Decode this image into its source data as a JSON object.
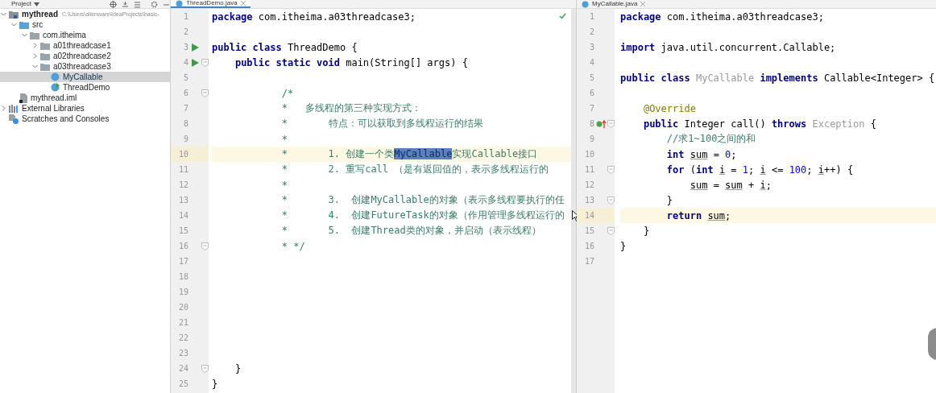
{
  "project_panel": {
    "title": "Project",
    "tree": [
      {
        "label": "mythread",
        "path": "C:\\Users\\alienware\\IdeaProjects\\basic-",
        "kind": "module",
        "expanded": true,
        "selected": false,
        "children": [
          {
            "label": "src",
            "kind": "source",
            "expanded": true,
            "selected": false,
            "children": [
              {
                "label": "com.itheima",
                "kind": "package",
                "expanded": true,
                "selected": false,
                "children": [
                  {
                    "label": "a01threadcase1",
                    "kind": "package",
                    "expanded": false,
                    "selected": false
                  },
                  {
                    "label": "a02threadcase2",
                    "kind": "package",
                    "expanded": false,
                    "selected": false
                  },
                  {
                    "label": "a03threadcase3",
                    "kind": "package",
                    "expanded": true,
                    "selected": false,
                    "children": [
                      {
                        "label": "MyCallable",
                        "kind": "class",
                        "selected": true
                      },
                      {
                        "label": "ThreadDemo",
                        "kind": "main-class",
                        "selected": false
                      }
                    ]
                  }
                ]
              }
            ]
          },
          {
            "label": "mythread.iml",
            "kind": "file",
            "selected": false
          }
        ]
      },
      {
        "label": "External Libraries",
        "kind": "libraries",
        "expanded": false,
        "selected": false
      },
      {
        "label": "Scratches and Consoles",
        "kind": "scratches",
        "selected": false
      }
    ]
  },
  "editors": [
    {
      "tab": {
        "label": "ThreadDemo.java",
        "selected": true
      },
      "lines": [
        {
          "number": "1",
          "fold": false,
          "current": false,
          "tokens": [
            {
              "kind": "keyword",
              "text": "package"
            },
            {
              "kind": "plain",
              "text": " com.itheima.a03threadcase3;"
            }
          ]
        },
        {
          "number": "2",
          "fold": false,
          "current": false
        },
        {
          "number": "3",
          "fold": false,
          "current": false,
          "gutter_icon": {
            "kind": "run"
          },
          "tokens": [
            {
              "kind": "keyword",
              "text": "public class"
            },
            {
              "kind": "plain",
              "text": " ThreadDemo {"
            }
          ]
        },
        {
          "number": "4",
          "fold": true,
          "current": false,
          "gutter_icon": {
            "kind": "run"
          },
          "tokens": [
            {
              "kind": "keyword",
              "text": "    public static void"
            },
            {
              "kind": "plain",
              "text": " main(String[] args) {"
            }
          ]
        },
        {
          "number": "5",
          "fold": false,
          "current": false
        },
        {
          "number": "6",
          "fold": true,
          "current": false,
          "tokens": [
            {
              "kind": "comment",
              "text": "            /*"
            }
          ]
        },
        {
          "number": "7",
          "fold": false,
          "current": false,
          "tokens": [
            {
              "kind": "comment",
              "text": "            *   多线程的第三种实现方式："
            }
          ]
        },
        {
          "number": "8",
          "fold": false,
          "current": false,
          "tokens": [
            {
              "kind": "comment",
              "text": "            *       特点：可以获取到多线程运行的结果"
            }
          ]
        },
        {
          "number": "9",
          "fold": false,
          "current": false,
          "tokens": [
            {
              "kind": "comment",
              "text": "            *"
            }
          ]
        },
        {
          "number": "10",
          "fold": false,
          "current": true,
          "tokens": [
            {
              "kind": "comment",
              "text": "            *       1. 创建一个类"
            },
            {
              "kind": "selection",
              "text": "MyCallable"
            },
            {
              "kind": "comment",
              "text": "实现Callable接口"
            }
          ]
        },
        {
          "number": "11",
          "fold": false,
          "current": false,
          "tokens": [
            {
              "kind": "comment",
              "text": "            *       2. 重写call （是有返回值的，表示多线程运行的"
            }
          ]
        },
        {
          "number": "12",
          "fold": false,
          "current": false,
          "tokens": [
            {
              "kind": "comment",
              "text": "            *"
            }
          ]
        },
        {
          "number": "13",
          "fold": false,
          "current": false,
          "tokens": [
            {
              "kind": "comment",
              "text": "            *       3.  创建MyCallable的对象（表示多线程要执行的任"
            }
          ]
        },
        {
          "number": "14",
          "fold": false,
          "current": false,
          "tokens": [
            {
              "kind": "comment",
              "text": "            *       4.  创建FutureTask的对象（作用管理多线程运行的"
            }
          ]
        },
        {
          "number": "15",
          "fold": false,
          "current": false,
          "tokens": [
            {
              "kind": "comment",
              "text": "            *       5.  创建Thread类的对象，并启动（表示线程）"
            }
          ]
        },
        {
          "number": "16",
          "fold": true,
          "current": false,
          "tokens": [
            {
              "kind": "comment",
              "text": "            * */"
            }
          ]
        },
        {
          "number": "17",
          "fold": false,
          "current": false
        },
        {
          "number": "18",
          "fold": false,
          "current": false
        },
        {
          "number": "19",
          "fold": false,
          "current": false
        },
        {
          "number": "20",
          "fold": false,
          "current": false
        },
        {
          "number": "21",
          "fold": false,
          "current": false
        },
        {
          "number": "22",
          "fold": false,
          "current": false
        },
        {
          "number": "23",
          "fold": false,
          "current": false
        },
        {
          "number": "24",
          "fold": true,
          "current": false,
          "tokens": [
            {
              "kind": "plain",
              "text": "    }"
            }
          ]
        },
        {
          "number": "25",
          "fold": false,
          "current": false,
          "tokens": [
            {
              "kind": "plain",
              "text": "}"
            }
          ]
        }
      ]
    },
    {
      "tab": {
        "label": "MyCallable.java",
        "selected": false
      },
      "lines": [
        {
          "number": "1",
          "fold": false,
          "current": false,
          "tokens": [
            {
              "kind": "keyword",
              "text": "package"
            },
            {
              "kind": "plain",
              "text": " com.itheima.a03threadcase3;"
            }
          ]
        },
        {
          "number": "2",
          "fold": false,
          "current": false
        },
        {
          "number": "3",
          "fold": false,
          "current": false,
          "tokens": [
            {
              "kind": "keyword",
              "text": "import"
            },
            {
              "kind": "plain",
              "text": " java.util.concurrent.Callable;"
            }
          ]
        },
        {
          "number": "4",
          "fold": false,
          "current": false
        },
        {
          "number": "5",
          "fold": false,
          "current": false,
          "tokens": [
            {
              "kind": "keyword",
              "text": "public class"
            },
            {
              "kind": "muted",
              "text": " MyCallable"
            },
            {
              "kind": "keyword",
              "text": " implements"
            },
            {
              "kind": "plain",
              "text": " Callable<Integer> {"
            }
          ]
        },
        {
          "number": "6",
          "fold": false,
          "current": false
        },
        {
          "number": "7",
          "fold": false,
          "current": false,
          "tokens": [
            {
              "kind": "annotation",
              "text": "    @Override"
            }
          ]
        },
        {
          "number": "8",
          "fold": true,
          "current": false,
          "gutter_icon": {
            "kind": "override"
          },
          "tokens": [
            {
              "kind": "keyword",
              "text": "    public"
            },
            {
              "kind": "plain",
              "text": " Integer call() "
            },
            {
              "kind": "keyword",
              "text": "throws"
            },
            {
              "kind": "muted",
              "text": " Exception"
            },
            {
              "kind": "plain",
              "text": " {"
            }
          ]
        },
        {
          "number": "9",
          "fold": false,
          "current": false,
          "tokens": [
            {
              "kind": "comment",
              "text": "        //求1~100之间的和"
            }
          ]
        },
        {
          "number": "10",
          "fold": false,
          "current": false,
          "tokens": [
            {
              "kind": "keyword",
              "text": "        int"
            },
            {
              "kind": "variable",
              "text": " sum"
            },
            {
              "kind": "plain",
              "text": " = "
            },
            {
              "kind": "number",
              "text": "0"
            },
            {
              "kind": "plain",
              "text": ";"
            }
          ]
        },
        {
          "number": "11",
          "fold": true,
          "current": false,
          "tokens": [
            {
              "kind": "keyword",
              "text": "        for"
            },
            {
              "kind": "plain",
              "text": " ("
            },
            {
              "kind": "keyword",
              "text": "int"
            },
            {
              "kind": "variable",
              "text": " i"
            },
            {
              "kind": "plain",
              "text": " = "
            },
            {
              "kind": "number",
              "text": "1"
            },
            {
              "kind": "plain",
              "text": "; "
            },
            {
              "kind": "variable",
              "text": "i"
            },
            {
              "kind": "plain",
              "text": " <= "
            },
            {
              "kind": "number",
              "text": "100"
            },
            {
              "kind": "plain",
              "text": "; "
            },
            {
              "kind": "variable",
              "text": "i"
            },
            {
              "kind": "plain",
              "text": "++) {"
            }
          ]
        },
        {
          "number": "12",
          "fold": false,
          "current": false,
          "tokens": [
            {
              "kind": "variable",
              "text": "            sum"
            },
            {
              "kind": "plain",
              "text": " = "
            },
            {
              "kind": "variable",
              "text": "sum"
            },
            {
              "kind": "plain",
              "text": " + "
            },
            {
              "kind": "variable",
              "text": "i"
            },
            {
              "kind": "plain",
              "text": ";"
            }
          ]
        },
        {
          "number": "13",
          "fold": true,
          "current": false,
          "tokens": [
            {
              "kind": "plain",
              "text": "        }"
            }
          ]
        },
        {
          "number": "14",
          "fold": false,
          "current": true,
          "tokens": [
            {
              "kind": "keyword",
              "text": "        return"
            },
            {
              "kind": "variable",
              "text": " sum"
            },
            {
              "kind": "plain",
              "text": ";"
            }
          ]
        },
        {
          "number": "15",
          "fold": true,
          "current": false,
          "tokens": [
            {
              "kind": "plain",
              "text": "    }"
            }
          ]
        },
        {
          "number": "16",
          "fold": false,
          "current": false,
          "tokens": [
            {
              "kind": "plain",
              "text": "}"
            }
          ]
        },
        {
          "number": "17",
          "fold": false,
          "current": false
        }
      ]
    }
  ]
}
